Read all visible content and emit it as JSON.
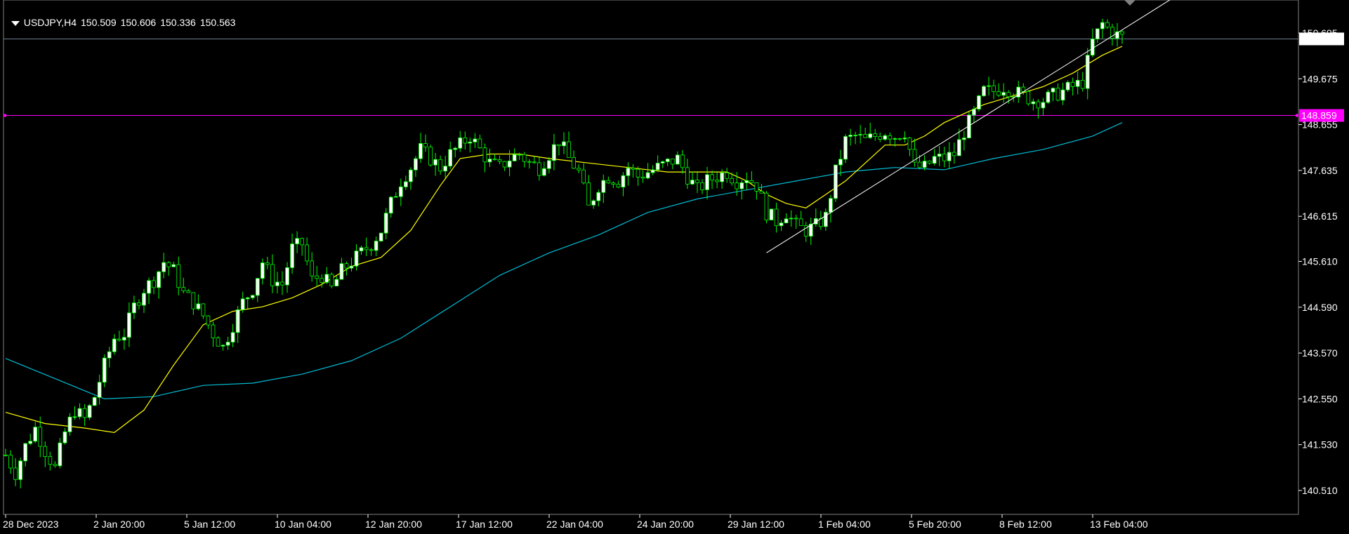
{
  "header": {
    "symbol": "USDJPY,H4",
    "open": "150.509",
    "high": "150.606",
    "low": "150.336",
    "close": "150.563"
  },
  "colors": {
    "background": "#000000",
    "grid_frame": "#ffffff",
    "bull_candle": "#00ff00",
    "bull_body": "#ffffff",
    "bear_candle": "#00ff00",
    "bear_body": "#000000",
    "ma_fast": "#ffff00",
    "ma_slow": "#00bcd4",
    "level_line": "#ff00ff",
    "current_line": "#708090",
    "trendline": "#ffffff"
  },
  "chart_data": {
    "type": "candlestick",
    "title": "",
    "y_ticks": [
      "150.695",
      "149.675",
      "148.655",
      "147.635",
      "146.615",
      "145.610",
      "144.590",
      "143.570",
      "142.550",
      "141.530",
      "140.510"
    ],
    "ylim": [
      140.0,
      151.5
    ],
    "x_ticks": [
      "28 Dec 2023",
      "2 Jan 20:00",
      "5 Jan 12:00",
      "10 Jan 04:00",
      "12 Jan 20:00",
      "17 Jan 12:00",
      "22 Jan 04:00",
      "24 Jan 20:00",
      "29 Jan 12:00",
      "1 Feb 04:00",
      "5 Feb 20:00",
      "8 Feb 12:00",
      "13 Feb 04:00"
    ],
    "level_label": "148.859",
    "level_value": 148.859,
    "current_label": "150.563",
    "current_value": 150.563,
    "close_path": [
      [
        0,
        141.3
      ],
      [
        2,
        140.9
      ],
      [
        4,
        141.5
      ],
      [
        6,
        141.9
      ],
      [
        8,
        141.4
      ],
      [
        10,
        141.0
      ],
      [
        12,
        141.8
      ],
      [
        14,
        142.3
      ],
      [
        16,
        142.1
      ],
      [
        18,
        142.6
      ],
      [
        20,
        143.3
      ],
      [
        22,
        143.9
      ],
      [
        24,
        144.0
      ],
      [
        26,
        144.6
      ],
      [
        28,
        145.0
      ],
      [
        30,
        145.2
      ],
      [
        32,
        145.6
      ],
      [
        34,
        145.4
      ],
      [
        36,
        144.9
      ],
      [
        38,
        144.7
      ],
      [
        40,
        144.4
      ],
      [
        42,
        144.0
      ],
      [
        44,
        143.7
      ],
      [
        46,
        144.2
      ],
      [
        48,
        144.7
      ],
      [
        50,
        145.0
      ],
      [
        52,
        145.6
      ],
      [
        54,
        145.2
      ],
      [
        56,
        145.1
      ],
      [
        58,
        145.9
      ],
      [
        60,
        146.0
      ],
      [
        62,
        145.2
      ],
      [
        64,
        145.3
      ],
      [
        66,
        145.0
      ],
      [
        68,
        145.4
      ],
      [
        70,
        145.6
      ],
      [
        72,
        145.8
      ],
      [
        74,
        146.0
      ],
      [
        76,
        146.3
      ],
      [
        78,
        146.9
      ],
      [
        80,
        147.4
      ],
      [
        82,
        147.7
      ],
      [
        84,
        148.1
      ],
      [
        86,
        147.9
      ],
      [
        88,
        147.7
      ],
      [
        90,
        148.0
      ],
      [
        92,
        148.2
      ],
      [
        94,
        148.4
      ],
      [
        96,
        148.1
      ],
      [
        98,
        147.8
      ],
      [
        100,
        147.7
      ],
      [
        102,
        147.9
      ],
      [
        104,
        148.0
      ],
      [
        106,
        147.8
      ],
      [
        108,
        147.7
      ],
      [
        110,
        148.0
      ],
      [
        112,
        148.3
      ],
      [
        114,
        147.9
      ],
      [
        116,
        147.6
      ],
      [
        118,
        146.8
      ],
      [
        120,
        147.3
      ],
      [
        122,
        147.5
      ],
      [
        124,
        147.4
      ],
      [
        126,
        147.7
      ],
      [
        128,
        147.5
      ],
      [
        130,
        147.6
      ],
      [
        132,
        147.7
      ],
      [
        134,
        147.8
      ],
      [
        136,
        147.9
      ],
      [
        138,
        147.5
      ],
      [
        140,
        147.2
      ],
      [
        142,
        147.4
      ],
      [
        144,
        147.5
      ],
      [
        146,
        147.6
      ],
      [
        148,
        147.4
      ],
      [
        150,
        147.5
      ],
      [
        152,
        147.3
      ],
      [
        154,
        146.7
      ],
      [
        156,
        146.5
      ],
      [
        158,
        146.7
      ],
      [
        160,
        146.4
      ],
      [
        162,
        146.3
      ],
      [
        164,
        146.4
      ],
      [
        166,
        146.6
      ],
      [
        168,
        147.6
      ],
      [
        170,
        148.3
      ],
      [
        172,
        148.4
      ],
      [
        174,
        148.3
      ],
      [
        176,
        148.4
      ],
      [
        178,
        148.5
      ],
      [
        180,
        148.4
      ],
      [
        182,
        148.5
      ],
      [
        184,
        147.7
      ],
      [
        186,
        147.7
      ],
      [
        188,
        147.9
      ],
      [
        190,
        147.9
      ],
      [
        192,
        148.0
      ],
      [
        194,
        148.5
      ],
      [
        196,
        148.9
      ],
      [
        198,
        149.4
      ],
      [
        200,
        149.4
      ],
      [
        202,
        149.5
      ],
      [
        204,
        149.4
      ],
      [
        206,
        149.3
      ],
      [
        208,
        149.2
      ],
      [
        210,
        149.2
      ],
      [
        212,
        149.3
      ],
      [
        214,
        149.4
      ],
      [
        216,
        149.5
      ],
      [
        218,
        149.6
      ],
      [
        220,
        150.5
      ],
      [
        222,
        150.9
      ],
      [
        224,
        150.7
      ],
      [
        226,
        150.6
      ]
    ],
    "ma_fast_path": [
      [
        0,
        142.25
      ],
      [
        8,
        142.0
      ],
      [
        16,
        141.9
      ],
      [
        22,
        141.8
      ],
      [
        28,
        142.3
      ],
      [
        34,
        143.3
      ],
      [
        40,
        144.2
      ],
      [
        46,
        144.5
      ],
      [
        52,
        144.6
      ],
      [
        58,
        144.8
      ],
      [
        64,
        145.1
      ],
      [
        70,
        145.5
      ],
      [
        76,
        145.7
      ],
      [
        82,
        146.3
      ],
      [
        88,
        147.3
      ],
      [
        92,
        147.9
      ],
      [
        98,
        148.0
      ],
      [
        104,
        148.0
      ],
      [
        110,
        147.9
      ],
      [
        118,
        147.8
      ],
      [
        126,
        147.7
      ],
      [
        134,
        147.6
      ],
      [
        140,
        147.6
      ],
      [
        146,
        147.6
      ],
      [
        150,
        147.4
      ],
      [
        154,
        147.1
      ],
      [
        158,
        146.9
      ],
      [
        162,
        146.8
      ],
      [
        166,
        147.1
      ],
      [
        170,
        147.4
      ],
      [
        174,
        147.8
      ],
      [
        178,
        148.2
      ],
      [
        182,
        148.2
      ],
      [
        186,
        148.4
      ],
      [
        190,
        148.7
      ],
      [
        194,
        148.9
      ],
      [
        198,
        149.1
      ],
      [
        204,
        149.3
      ],
      [
        210,
        149.5
      ],
      [
        216,
        149.8
      ],
      [
        222,
        150.2
      ],
      [
        226,
        150.4
      ]
    ],
    "ma_slow_path": [
      [
        0,
        143.45
      ],
      [
        10,
        143.0
      ],
      [
        20,
        142.55
      ],
      [
        30,
        142.6
      ],
      [
        40,
        142.85
      ],
      [
        50,
        142.9
      ],
      [
        60,
        143.1
      ],
      [
        70,
        143.4
      ],
      [
        80,
        143.9
      ],
      [
        90,
        144.6
      ],
      [
        100,
        145.3
      ],
      [
        110,
        145.8
      ],
      [
        120,
        146.2
      ],
      [
        130,
        146.7
      ],
      [
        140,
        147.0
      ],
      [
        150,
        147.2
      ],
      [
        160,
        147.4
      ],
      [
        170,
        147.6
      ],
      [
        180,
        147.7
      ],
      [
        190,
        147.65
      ],
      [
        200,
        147.9
      ],
      [
        210,
        148.1
      ],
      [
        220,
        148.4
      ],
      [
        226,
        148.7
      ]
    ],
    "trendline": [
      [
        154,
        145.8
      ],
      [
        241,
        151.8
      ]
    ],
    "x_count": 226
  }
}
